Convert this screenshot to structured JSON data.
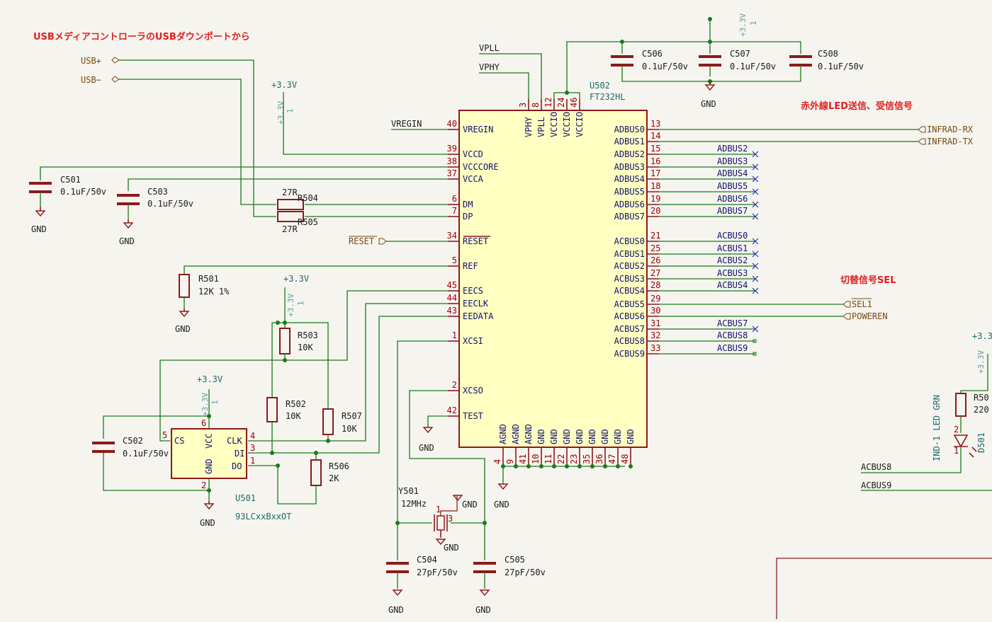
{
  "notes": {
    "usb_source": "USBメディアコントローラのUSBダウンポートから",
    "infrared": "赤外線LED送信、受信信号",
    "switch_sel": "切替信号SEL"
  },
  "ic_u502": {
    "ref": "U502",
    "value": "FT232HL",
    "left_pins": [
      {
        "num": "40",
        "name": "VREGIN"
      },
      {
        "num": "39",
        "name": "VCCD"
      },
      {
        "num": "38",
        "name": "VCCCORE"
      },
      {
        "num": "37",
        "name": "VCCA"
      },
      {
        "num": "6",
        "name": "DM"
      },
      {
        "num": "7",
        "name": "DP"
      },
      {
        "num": "34",
        "name": "RESET"
      },
      {
        "num": "5",
        "name": "REF"
      },
      {
        "num": "45",
        "name": "EECS"
      },
      {
        "num": "44",
        "name": "EECLK"
      },
      {
        "num": "43",
        "name": "EEDATA"
      },
      {
        "num": "1",
        "name": "XCSI"
      },
      {
        "num": "2",
        "name": "XCSO"
      },
      {
        "num": "42",
        "name": "TEST"
      }
    ],
    "right_pins": [
      {
        "num": "13",
        "name": "ADBUS0"
      },
      {
        "num": "14",
        "name": "ADBUS1"
      },
      {
        "num": "15",
        "name": "ADBUS2"
      },
      {
        "num": "16",
        "name": "ADBUS3"
      },
      {
        "num": "17",
        "name": "ADBUS4"
      },
      {
        "num": "18",
        "name": "ADBUS5"
      },
      {
        "num": "19",
        "name": "ADBUS6"
      },
      {
        "num": "20",
        "name": "ADBUS7"
      },
      {
        "num": "21",
        "name": "ACBUS0"
      },
      {
        "num": "25",
        "name": "ACBUS1"
      },
      {
        "num": "26",
        "name": "ACBUS2"
      },
      {
        "num": "27",
        "name": "ACBUS3"
      },
      {
        "num": "28",
        "name": "ACBUS4"
      },
      {
        "num": "29",
        "name": "ACBUS5"
      },
      {
        "num": "30",
        "name": "ACBUS6"
      },
      {
        "num": "31",
        "name": "ACBUS7"
      },
      {
        "num": "32",
        "name": "ACBUS8"
      },
      {
        "num": "33",
        "name": "ACBUS9"
      }
    ],
    "top_pins": [
      {
        "num": "3",
        "name": "VPHY"
      },
      {
        "num": "8",
        "name": "VPLL"
      },
      {
        "num": "12",
        "name": "VCCIO"
      },
      {
        "num": "24",
        "name": "VCCIO"
      },
      {
        "num": "46",
        "name": "VCCIO"
      }
    ],
    "bottom_pins": [
      {
        "num": "4",
        "name": "AGND"
      },
      {
        "num": "9",
        "name": "AGND"
      },
      {
        "num": "41",
        "name": "AGND"
      },
      {
        "num": "10",
        "name": "GND"
      },
      {
        "num": "11",
        "name": "GND"
      },
      {
        "num": "22",
        "name": "GND"
      },
      {
        "num": "23",
        "name": "GND"
      },
      {
        "num": "35",
        "name": "GND"
      },
      {
        "num": "36",
        "name": "GND"
      },
      {
        "num": "47",
        "name": "GND"
      },
      {
        "num": "48",
        "name": "GND"
      }
    ]
  },
  "right_net_labels": [
    "ADBUS2",
    "ADBUS3",
    "ADBUS4",
    "ADBUS5",
    "ADBUS6",
    "ADBUS7",
    "ACBUS0",
    "ACBUS1",
    "ACBUS2",
    "ACBUS3",
    "ACBUS4",
    "ACBUS7",
    "ACBUS8",
    "ACBUS9"
  ],
  "hier_labels": {
    "usbp": "USB+",
    "usbm": "USB−",
    "reset": "RESET",
    "irrx": "INFRAD-RX",
    "irtx": "INFRAD-TX",
    "sel": "SEL1",
    "poweren": "POWEREN"
  },
  "nets": {
    "vpll": "VPLL",
    "vphy": "VPHY",
    "vregin": "VREGIN",
    "acbus8": "ACBUS8",
    "acbus9": "ACBUS9"
  },
  "power": {
    "v33": "+3.3V",
    "pwr_ref": "+3.3V",
    "pwr_pin": "1",
    "gnd": "GND"
  },
  "components": {
    "c501": {
      "ref": "C501",
      "value": "0.1uF/50v"
    },
    "c503": {
      "ref": "C503",
      "value": "0.1uF/50v"
    },
    "c506": {
      "ref": "C506",
      "value": "0.1uF/50v"
    },
    "c507": {
      "ref": "C507",
      "value": "0.1uF/50v"
    },
    "c508": {
      "ref": "C508",
      "value": "0.1uF/50v"
    },
    "c502": {
      "ref": "C502",
      "value": "0.1uF/50v"
    },
    "c504": {
      "ref": "C504",
      "value": "27pF/50v"
    },
    "c505": {
      "ref": "C505",
      "value": "27pF/50v"
    },
    "r504": {
      "ref": "R504",
      "value": "27R"
    },
    "r505": {
      "ref": "R505",
      "value": "27R"
    },
    "r501": {
      "ref": "R501",
      "value": "12K 1%"
    },
    "r503": {
      "ref": "R503",
      "value": "10K"
    },
    "r502": {
      "ref": "R502",
      "value": "10K"
    },
    "r507": {
      "ref": "R507",
      "value": "10K"
    },
    "r506": {
      "ref": "R506",
      "value": "2K"
    },
    "r508": {
      "ref": "R50",
      "value": "220"
    },
    "y501": {
      "ref": "Y501",
      "value": "12MHz"
    },
    "d501": {
      "ref": "D501",
      "value": "IND-1 LED GRN"
    }
  },
  "ic_u501": {
    "ref": "U501",
    "value": "93LCxxBxxOT",
    "pins": [
      {
        "num": "5",
        "name": "CS"
      },
      {
        "num": "6",
        "name": "VCC"
      },
      {
        "num": "2",
        "name": "GND"
      },
      {
        "num": "4",
        "name": "CLK"
      },
      {
        "num": "3",
        "name": "DI"
      },
      {
        "num": "1",
        "name": "DO"
      }
    ]
  },
  "misc": {
    "y_pin1": "1",
    "y_pin3": "3",
    "r_pin1": "1",
    "r_pin2": "2",
    "v33_partial": "+3.3"
  }
}
